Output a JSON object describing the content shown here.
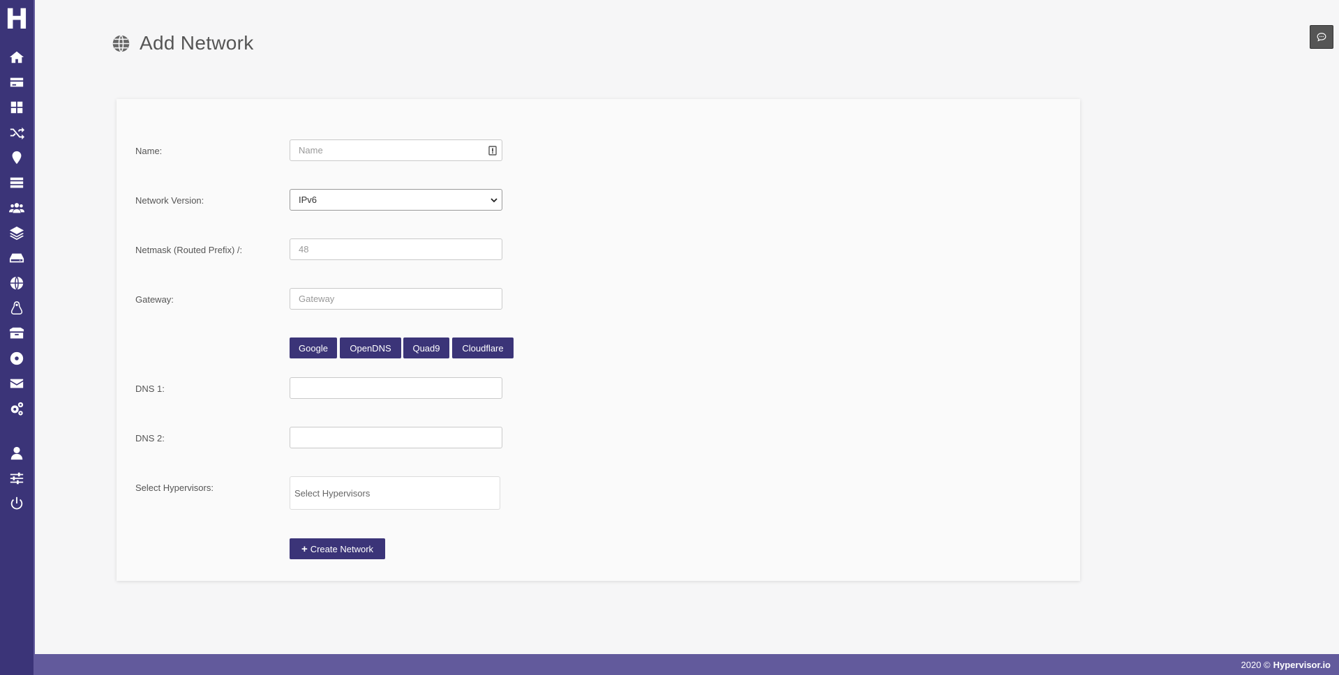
{
  "logo": "H",
  "sidebar": {
    "items": [
      {
        "icon": "home-icon"
      },
      {
        "icon": "credit-card-icon"
      },
      {
        "icon": "dashboard-grid-icon"
      },
      {
        "icon": "shuffle-icon"
      },
      {
        "icon": "map-pin-icon"
      },
      {
        "icon": "server-icon"
      },
      {
        "icon": "users-icon"
      },
      {
        "icon": "layers-icon"
      },
      {
        "icon": "hard-drive-icon"
      },
      {
        "icon": "globe-icon"
      },
      {
        "icon": "linux-icon"
      },
      {
        "icon": "boxes-icon"
      },
      {
        "icon": "disc-icon"
      },
      {
        "icon": "envelope-icon"
      },
      {
        "icon": "cogs-icon"
      },
      {
        "icon": "user-icon"
      },
      {
        "icon": "sliders-icon"
      },
      {
        "icon": "power-icon"
      }
    ]
  },
  "header": {
    "title": "Add Network",
    "icon": "globe-icon"
  },
  "form": {
    "name": {
      "label": "Name:",
      "placeholder": "Name"
    },
    "version": {
      "label": "Network Version:",
      "value": "IPv6"
    },
    "netmask": {
      "label": "Netmask (Routed Prefix) /:",
      "placeholder": "48"
    },
    "gateway": {
      "label": "Gateway:",
      "placeholder": "Gateway"
    },
    "dns_buttons": [
      "Google",
      "OpenDNS",
      "Quad9",
      "Cloudflare"
    ],
    "dns1": {
      "label": "DNS 1:",
      "value": ""
    },
    "dns2": {
      "label": "DNS 2:",
      "value": ""
    },
    "hypervisors": {
      "label": "Select Hypervisors:",
      "placeholder": "Select Hypervisors"
    },
    "submit_label": "Create Network"
  },
  "footer": {
    "year": "2020 ©",
    "brand": "Hypervisor.io"
  },
  "colors": {
    "sidebar": "#3b3478",
    "footer": "#625a9c",
    "button": "#3b3478"
  }
}
